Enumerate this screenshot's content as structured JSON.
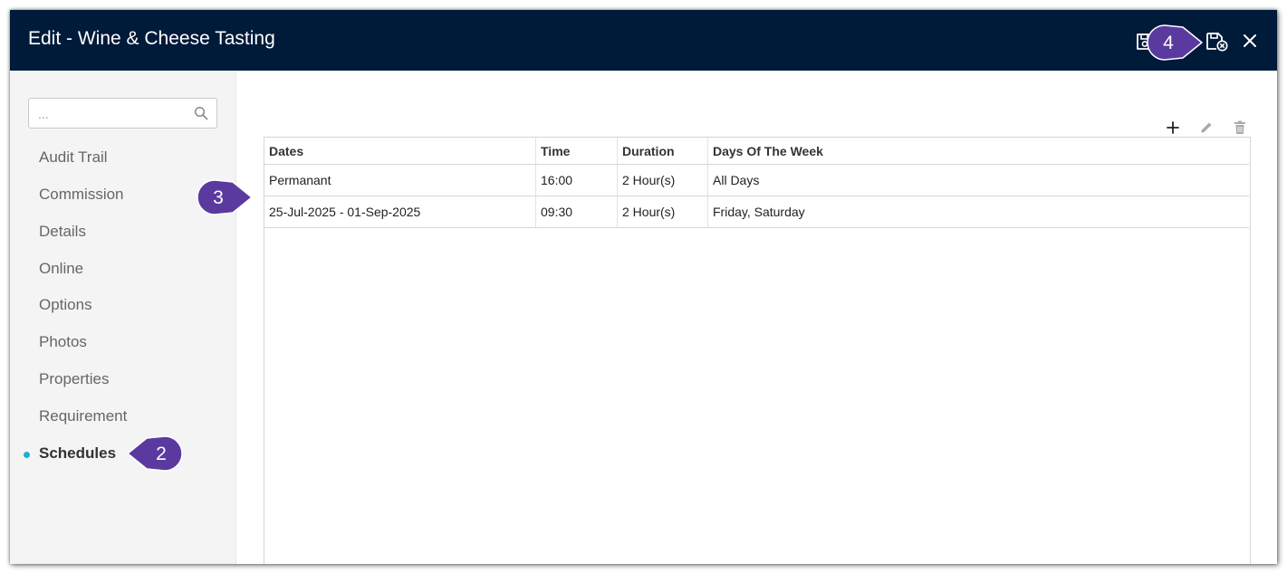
{
  "header": {
    "title": "Edit - Wine & Cheese Tasting",
    "actions": [
      {
        "name": "save-icon",
        "kind": "action"
      },
      {
        "name": "save-and-close-icon",
        "kind": "action"
      },
      {
        "name": "close-icon",
        "kind": "action"
      }
    ]
  },
  "sidebar": {
    "search": {
      "placeholder": "...",
      "value": ""
    },
    "items": [
      {
        "label": "Audit Trail",
        "active": false
      },
      {
        "label": "Commission",
        "active": false
      },
      {
        "label": "Details",
        "active": false
      },
      {
        "label": "Online",
        "active": false
      },
      {
        "label": "Options",
        "active": false
      },
      {
        "label": "Photos",
        "active": false
      },
      {
        "label": "Properties",
        "active": false
      },
      {
        "label": "Requirement",
        "active": false
      },
      {
        "label": "Schedules",
        "active": true
      }
    ]
  },
  "toolbar": {
    "icons": [
      "add-icon",
      "edit-icon",
      "delete-icon"
    ]
  },
  "table": {
    "columns": [
      "Dates",
      "Time",
      "Duration",
      "Days Of The Week"
    ],
    "rows": [
      [
        "Permanant",
        "16:00",
        "2 Hour(s)",
        "All Days"
      ],
      [
        "25-Jul-2025 - 01-Sep-2025",
        "09:30",
        "2 Hour(s)",
        "Friday, Saturday"
      ]
    ]
  },
  "callouts": {
    "two": "2",
    "three": "3",
    "four": "4"
  },
  "colors": {
    "header_bg": "#001a3a",
    "sidebar_bg": "#f4f4f4",
    "active_dot": "#17b2cf",
    "callout": "#5b3aa0"
  }
}
